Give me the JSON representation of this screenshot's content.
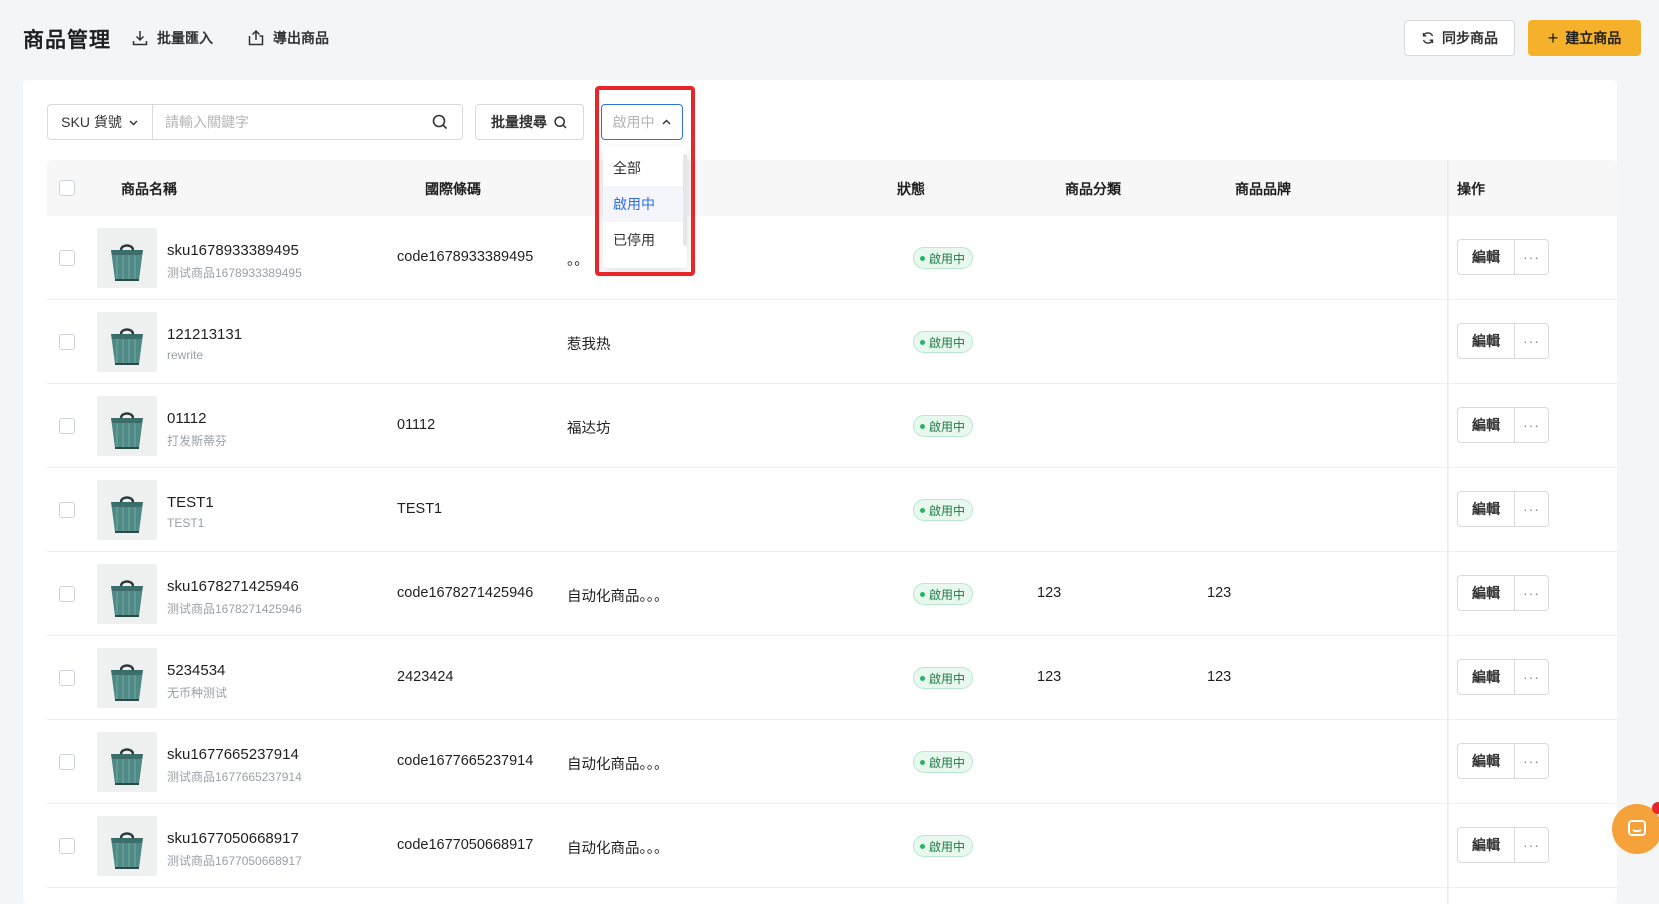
{
  "header": {
    "title": "商品管理",
    "import_label": "批量匯入",
    "export_label": "導出商品",
    "sync_label": "同步商品",
    "create_label": "建立商品"
  },
  "toolbar": {
    "field_select": "SKU 貨號",
    "search_placeholder": "請輸入關鍵字",
    "bulk_search_label": "批量搜尋",
    "status_placeholder": "啟用中"
  },
  "status_dropdown": {
    "options": [
      "全部",
      "啟用中",
      "已停用"
    ],
    "selected": "啟用中"
  },
  "table": {
    "columns": {
      "name": "商品名稱",
      "barcode": "國際條碼",
      "status": "狀態",
      "category": "商品分類",
      "brand": "商品品牌",
      "actions": "操作"
    },
    "edit_label": "編輯",
    "more_label": "···",
    "rows": [
      {
        "name": "sku1678933389495",
        "subname": "测试商品1678933389495",
        "barcode": "code1678933389495",
        "description": "。。",
        "status": "啟用中",
        "category": "",
        "brand": ""
      },
      {
        "name": "121213131",
        "subname": "rewrite",
        "barcode": "",
        "description": "惹我热",
        "status": "啟用中",
        "category": "",
        "brand": ""
      },
      {
        "name": "01112",
        "subname": "打发斯蒂芬",
        "barcode": "01112",
        "description": "福达坊",
        "status": "啟用中",
        "category": "",
        "brand": ""
      },
      {
        "name": "TEST1",
        "subname": "TEST1",
        "barcode": "TEST1",
        "description": "",
        "status": "啟用中",
        "category": "",
        "brand": ""
      },
      {
        "name": "sku1678271425946",
        "subname": "测试商品1678271425946",
        "barcode": "code1678271425946",
        "description": "自动化商品。。。",
        "status": "啟用中",
        "category": "123",
        "brand": "123"
      },
      {
        "name": "5234534",
        "subname": "无币种测试",
        "barcode": "2423424",
        "description": "",
        "status": "啟用中",
        "category": "123",
        "brand": "123"
      },
      {
        "name": "sku1677665237914",
        "subname": "测试商品1677665237914",
        "barcode": "code1677665237914",
        "description": "自动化商品。。。",
        "status": "啟用中",
        "category": "",
        "brand": ""
      },
      {
        "name": "sku1677050668917",
        "subname": "测试商品1677050668917",
        "barcode": "code1677050668917",
        "description": "自动化商品。。。",
        "status": "啟用中",
        "category": "",
        "brand": ""
      }
    ]
  },
  "colors": {
    "accent": "#f6b12b",
    "link_blue": "#2f6fe0",
    "status_green": "#28b463",
    "highlight_red": "#e8262a"
  }
}
